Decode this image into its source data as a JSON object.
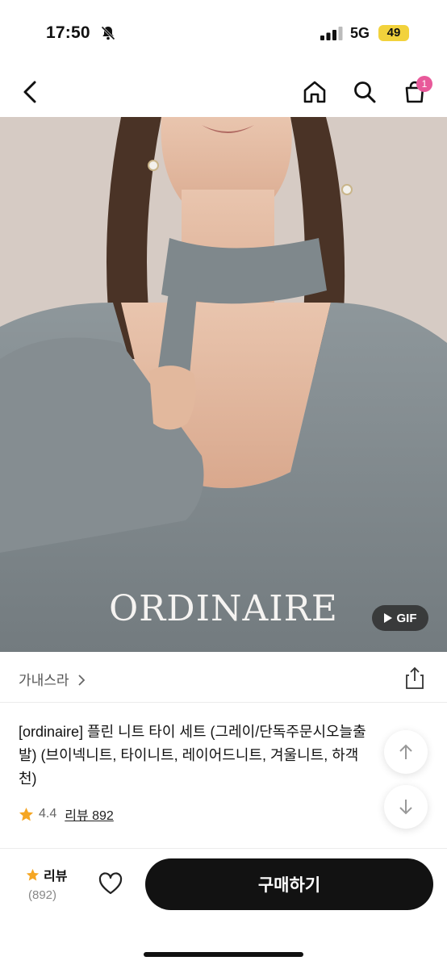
{
  "status": {
    "time": "17:50",
    "network": "5G",
    "battery": "49"
  },
  "header": {
    "cart_count": "1"
  },
  "hero": {
    "brand_text": "ORDINAIRE",
    "gif_label": "GIF"
  },
  "store": {
    "name": "가내스라"
  },
  "product": {
    "title": "[ordinaire] 플린 니트 타이 세트 (그레이/단독주문시오늘출발) (브이넥니트, 타이니트, 레이어드니트, 겨울니트, 하객 추천)",
    "title_line1": "[ordinaire] 플린 니트 타이 세트 (그레이/단독주문시오늘출",
    "title_line2": "발) (브이넥니트, 타이니트, 레이어드니트, 겨울니트, 하객",
    "title_line3": "천)",
    "rating": "4.4",
    "review_link": "리뷰 892"
  },
  "bottom_bar": {
    "review_label": "리뷰",
    "review_count": "(892)",
    "buy_label": "구매하기"
  },
  "colors": {
    "accent_star": "#f5a623",
    "cart_badge": "#e8599a",
    "buy_button": "#121212"
  }
}
